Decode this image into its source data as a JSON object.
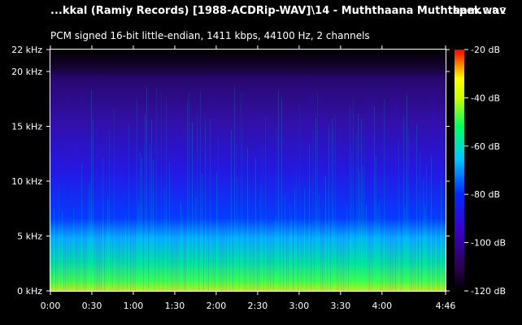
{
  "header": {
    "file_title": "...kkal (Ramiy Records) [1988-ACDRip-WAV]\\14 - Muththaana Muththam.wav",
    "app_name": "spek",
    "app_version": "0.8.2",
    "audio_info": "PCM signed 16-bit little-endian, 1411 kbps, 44100 Hz, 2 channels"
  },
  "chart_data": {
    "type": "heatmap",
    "frequency_axis": {
      "ticks": [
        {
          "label": "0 kHz",
          "value": 0
        },
        {
          "label": "5 kHz",
          "value": 5
        },
        {
          "label": "10 kHz",
          "value": 10
        },
        {
          "label": "15 kHz",
          "value": 15
        },
        {
          "label": "20 kHz",
          "value": 20
        },
        {
          "label": "22 kHz",
          "value": 22
        }
      ],
      "range": [
        0,
        22
      ]
    },
    "time_axis": {
      "ticks": [
        {
          "label": "0:00",
          "value": 0
        },
        {
          "label": "0:30",
          "value": 30
        },
        {
          "label": "1:00",
          "value": 60
        },
        {
          "label": "1:30",
          "value": 90
        },
        {
          "label": "2:00",
          "value": 120
        },
        {
          "label": "2:30",
          "value": 150
        },
        {
          "label": "3:00",
          "value": 180
        },
        {
          "label": "3:30",
          "value": 210
        },
        {
          "label": "4:00",
          "value": 240
        },
        {
          "label": "4:46",
          "value": 286
        }
      ],
      "range": [
        0,
        286
      ]
    },
    "level_scale": {
      "ticks": [
        {
          "label": "-20 dB",
          "value": -20
        },
        {
          "label": "-40 dB",
          "value": -40
        },
        {
          "label": "-60 dB",
          "value": -60
        },
        {
          "label": "-80 dB",
          "value": -80
        },
        {
          "label": "-100 dB",
          "value": -100
        },
        {
          "label": "-120 dB",
          "value": -120
        }
      ],
      "range": [
        -120,
        -20
      ],
      "colors": [
        "#000000",
        "#2a0050",
        "#3a00c8",
        "#0028ff",
        "#00c8ff",
        "#00ff60",
        "#c8ff00",
        "#ffff00",
        "#ff8000",
        "#ff0000"
      ]
    }
  }
}
